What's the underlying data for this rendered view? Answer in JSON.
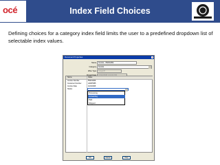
{
  "header": {
    "logo_text": "océ",
    "title": "Index Field Choices",
    "badge_text": "print software"
  },
  "description": "Defining choices for a category index field limits the user to a predefined dropdown list of selectable index values.",
  "dialog": {
    "title": "Document Properties",
    "fields": [
      {
        "label": "Name",
        "value": "Invoice - 55231469"
      },
      {
        "label": "Category",
        "value": "Invoice"
      },
      {
        "label": "Wise Type",
        "value": "Image/tif"
      },
      {
        "label": "Closed Date",
        "value": "10/22/2008  2:34:00 PM"
      }
    ],
    "grid": {
      "columns": [
        "Name",
        "Value"
      ],
      "rows": [
        {
          "name": "Invoice Number",
          "value": "55231469"
        },
        {
          "name": "Customer Number",
          "value": "A3087985"
        },
        {
          "name": "Invoice Date",
          "value": "10/2/2008"
        },
        {
          "name": "Status",
          "value": ""
        }
      ],
      "dropdown_options": [
        "Processing",
        "Forwarding",
        "Paid",
        "Shipped"
      ],
      "selected_option": "Forwarding"
    },
    "buttons": [
      "OK",
      "Cancel",
      "Help"
    ]
  }
}
